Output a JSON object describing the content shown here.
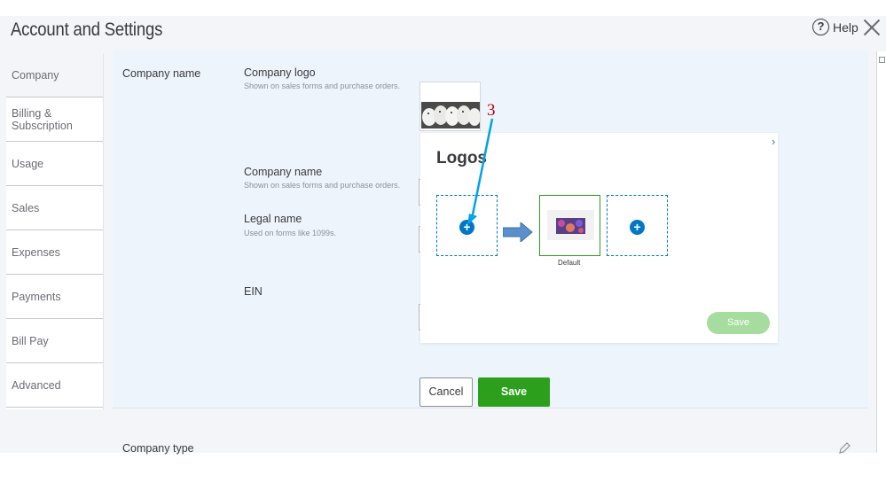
{
  "header": {
    "title": "Account and Settings",
    "help_label": "Help",
    "help_icon": "question-circle-icon",
    "close_icon": "close-x-icon"
  },
  "sidebar": {
    "items": [
      {
        "label": "Company",
        "active": true
      },
      {
        "label": "Billing & Subscription"
      },
      {
        "label": "Usage"
      },
      {
        "label": "Sales"
      },
      {
        "label": "Expenses"
      },
      {
        "label": "Payments"
      },
      {
        "label": "Bill Pay"
      },
      {
        "label": "Advanced"
      }
    ]
  },
  "company_section": {
    "title": "Company name",
    "logo_label": "Company logo",
    "logo_hint": "Shown on sales forms and purchase orders.",
    "name_label": "Company name",
    "name_hint": "Shown on sales forms and purchase orders.",
    "legal_label": "Legal name",
    "legal_hint": "Used on forms like 1099s.",
    "ein_label": "EIN",
    "cancel_label": "Cancel",
    "save_label": "Save"
  },
  "logos_modal": {
    "title": "Logos",
    "default_label": "Default",
    "save_label": "Save"
  },
  "annotation": {
    "step_number": "3",
    "color": "#00a2e8"
  },
  "company_type_section": {
    "title": "Company type"
  },
  "colors": {
    "accent_green": "#2ca01c",
    "accent_blue": "#0077c5",
    "disabled_green": "#a7dc9f",
    "annotation_red": "#c00000"
  }
}
